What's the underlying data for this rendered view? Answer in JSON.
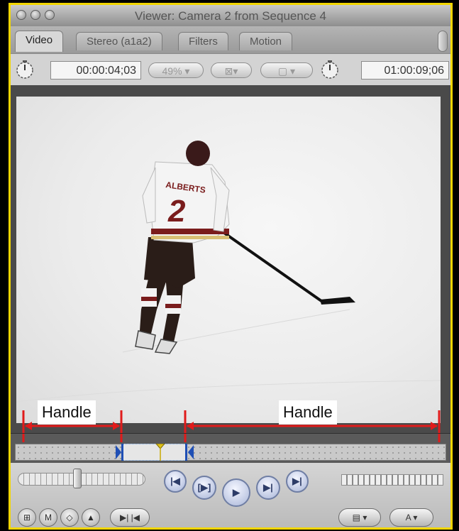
{
  "window": {
    "title": "Viewer: Camera 2 from Sequence 4"
  },
  "tabs": [
    {
      "label": "Video"
    },
    {
      "label": "Stereo (a1a2)"
    },
    {
      "label": "Filters"
    },
    {
      "label": "Motion"
    }
  ],
  "controls": {
    "duration": "00:00:04;03",
    "zoom": "49%",
    "current_timecode": "01:00:09;06"
  },
  "annotations": {
    "left_handle": "Handle",
    "right_handle": "Handle"
  },
  "player": {
    "jersey_name": "ALBERTS",
    "jersey_number": "2"
  },
  "colors": {
    "highlight_border": "#f2d600",
    "annotation_red": "#e01b1b",
    "marker_blue": "#1f4fb5"
  },
  "icons": {
    "close": "close-icon",
    "minimize": "minimize-icon",
    "zoom": "zoom-icon",
    "duration_dial": "duration-clock-icon",
    "timecode_dial": "timecode-clock-icon"
  }
}
